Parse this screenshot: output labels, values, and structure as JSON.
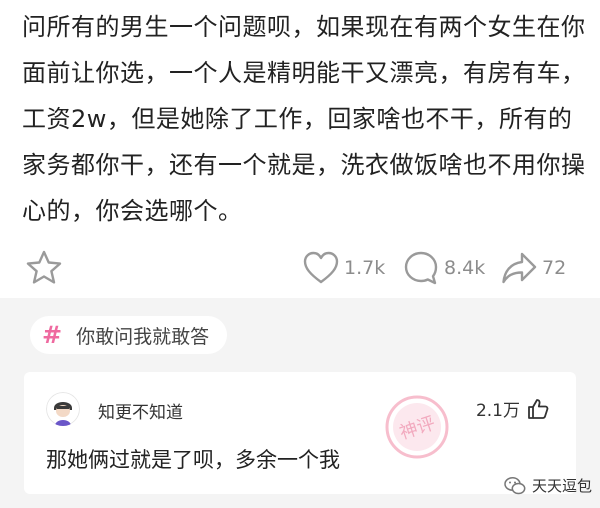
{
  "post": {
    "text": "问所有的男生一个问题呗，如果现在有两个女生在你面前让你选，一个人是精明能干又漂亮，有房有车，工资2w，但是她除了工作，回家啥也不干，所有的家务都你干，还有一个就是，洗衣做饭啥也不用你操心的，你会选哪个。"
  },
  "actions": {
    "star_icon": "star-icon",
    "likes": "1.7k",
    "comments": "8.4k",
    "shares": "72"
  },
  "topic": {
    "icon": "hash-icon",
    "label": "你敢问我就敢答"
  },
  "hot_comment": {
    "username": "知更不知道",
    "likes": "2.1万",
    "text": "那她俩过就是了呗，多余一个我",
    "stamp_text": "神评"
  },
  "watermark": {
    "text": "天天逗包"
  },
  "colors": {
    "accent_pink": "#ef6aa0",
    "icon_gray": "#9a9a9a",
    "stamp_pink": "#f28aa6"
  }
}
